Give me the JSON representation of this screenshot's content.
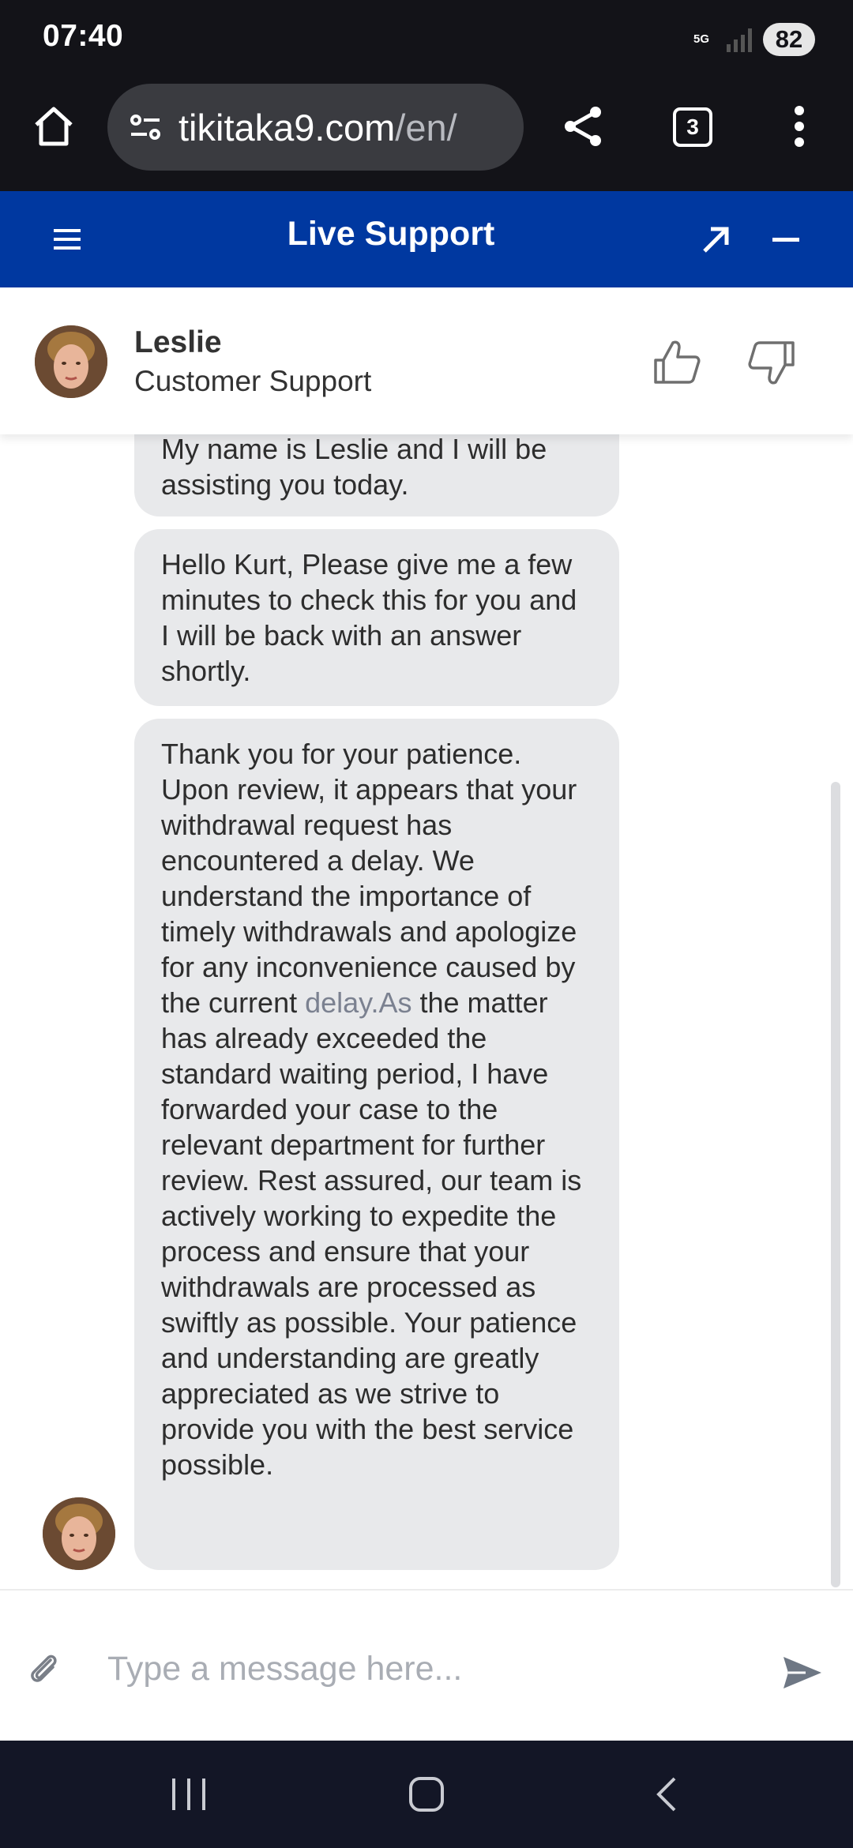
{
  "status_bar": {
    "time": "07:40",
    "network": "5G",
    "battery": "82"
  },
  "browser": {
    "url_host": "tikitaka9.com",
    "url_path": "/en/",
    "tab_count": "3",
    "icons": [
      "home-icon",
      "site-settings-icon",
      "share-icon",
      "tabs-icon",
      "more-vert-icon"
    ]
  },
  "support_header": {
    "title": "Live Support",
    "icons": [
      "hamburger-icon",
      "expand-icon",
      "minimize-icon"
    ]
  },
  "agent": {
    "name": "Leslie",
    "role": "Customer Support",
    "icons": [
      "thumbs-up-icon",
      "thumbs-down-icon"
    ]
  },
  "messages": [
    {
      "text": "My name is Leslie and I will be assisting you today."
    },
    {
      "text": "Hello Kurt, Please give me a few minutes to check this for you and I will be back with an answer shortly."
    },
    {
      "text_before": " Thank you for your patience. Upon review, it appears that your withdrawal request has encountered a delay. We understand the importance of timely withdrawals and apologize for any inconvenience caused by the current ",
      "link_text": "delay.As",
      "text_after": " the matter has already exceeded the standard waiting period, I have forwarded your case to the relevant department for further review. Rest assured, our team is actively working to expedite the process and ensure that your withdrawals are processed as swiftly as possible. Your patience and understanding are greatly appreciated as we strive to provide you with the best service possible."
    }
  ],
  "composer": {
    "placeholder": "Type a message here...",
    "icons": [
      "paperclip-icon",
      "send-icon"
    ]
  },
  "nav_bar": {
    "icons": [
      "recent-apps-icon",
      "home-circle-icon",
      "back-icon"
    ]
  },
  "colors": {
    "header_blue": "#0038a0",
    "bubble_gray": "#e8e9eb",
    "dark_bar": "#131318"
  }
}
